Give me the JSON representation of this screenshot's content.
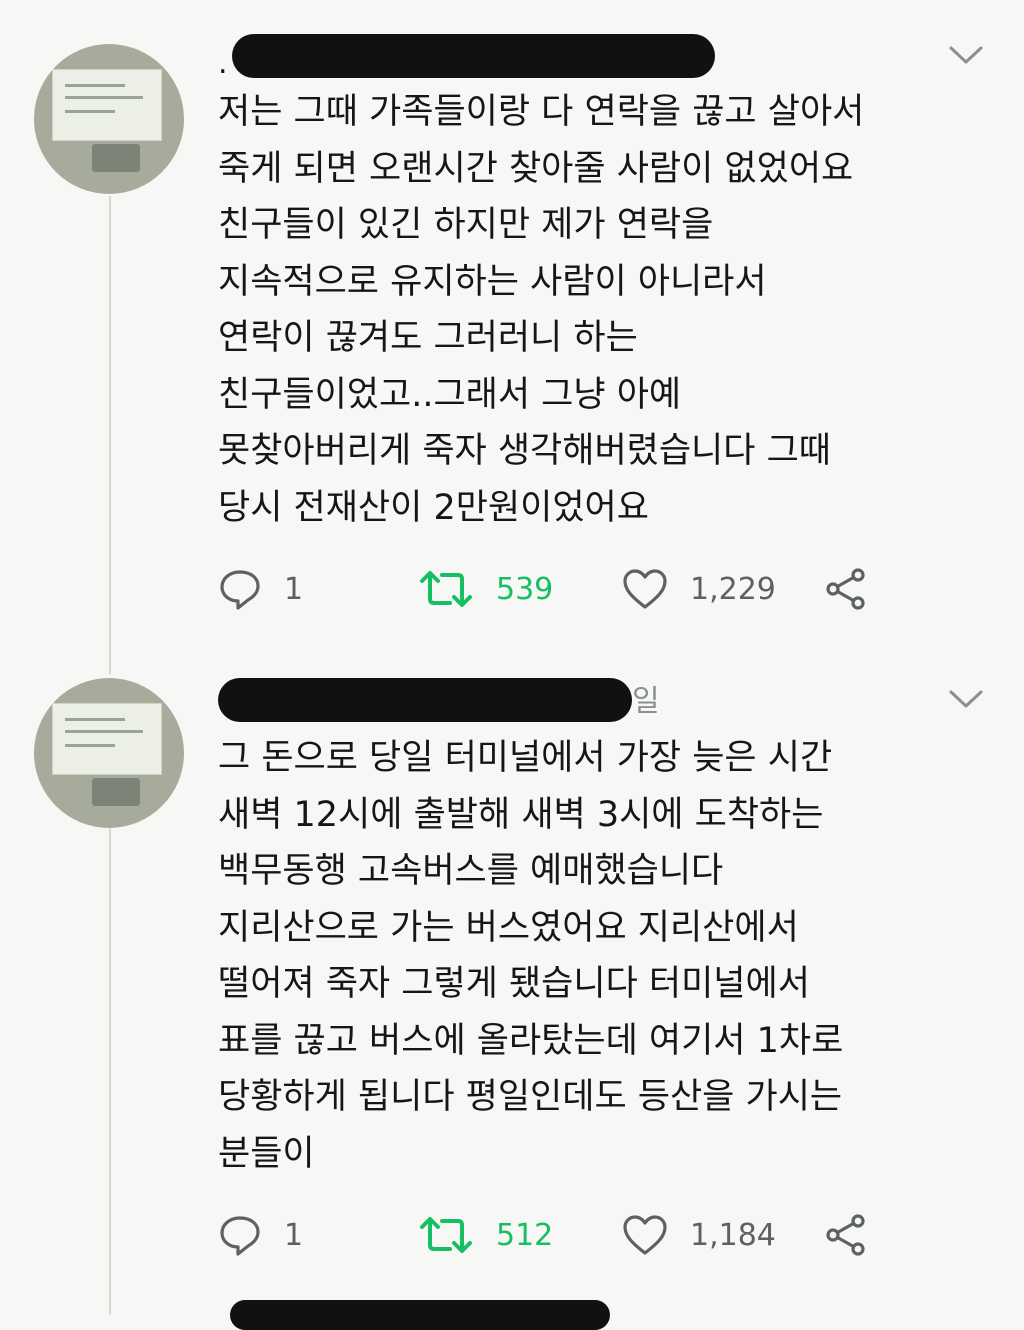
{
  "tweets": [
    {
      "author_suffix": "",
      "lines": [
        "저는 그때 가족들이랑 다 연락을 끊고 살아서",
        "죽게 되면 오랜시간 찾아줄 사람이 없었어요",
        "친구들이 있긴 하지만 제가 연락을",
        "지속적으로 유지하는 사람이 아니라서",
        "연락이 끊겨도 그러러니 하는",
        "친구들이었고..그래서 그냥 아예",
        "못찾아버리게 죽자 생각해버렸습니다 그때",
        "당시 전재산이 2만원이었어요"
      ],
      "replies": "1",
      "retweets": "539",
      "likes": "1,229"
    },
    {
      "author_suffix": "일",
      "lines": [
        "그 돈으로 당일 터미널에서 가장 늦은 시간",
        "새벽 12시에 출발해 새벽 3시에 도착하는",
        "백무동행 고속버스를 예매했습니다",
        "지리산으로 가는 버스였어요 지리산에서",
        "떨어져 죽자 그렇게 됐습니다 터미널에서",
        "표를 끊고 버스에 올라탔는데 여기서 1차로",
        "당황하게 됩니다 평일인데도 등산을 가시는",
        "분들이"
      ],
      "replies": "1",
      "retweets": "512",
      "likes": "1,184"
    }
  ],
  "icons": {
    "reply": "reply-icon",
    "retweet": "retweet-icon",
    "like": "heart-icon",
    "share": "share-icon",
    "menu": "chevron-down-icon"
  },
  "colors": {
    "retweet_active": "#17bf63",
    "muted": "#5c6166",
    "background": "#f7f8f5"
  }
}
